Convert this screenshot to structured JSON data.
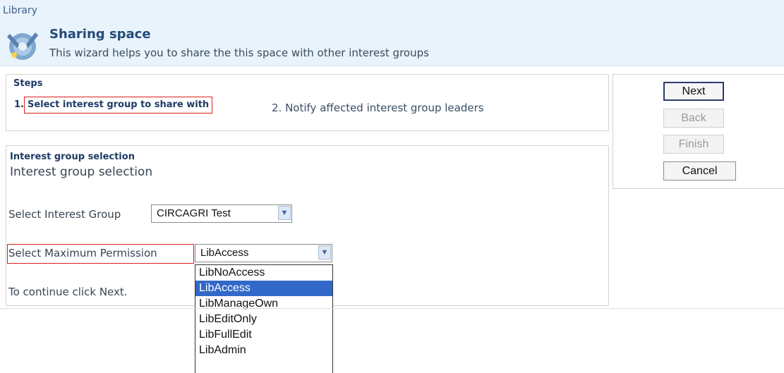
{
  "breadcrumb": "Library",
  "wizard": {
    "title": "Sharing space",
    "description": "This wizard helps you to share the this space with other interest groups"
  },
  "steps": {
    "heading": "Steps",
    "step1_number": "1.",
    "step1_label": "Select interest group to share with",
    "step2": "2. Notify affected interest group leaders"
  },
  "selection": {
    "heading": "Interest group selection",
    "subheading": "Interest group selection",
    "group_label": "Select Interest Group",
    "group_value": "CIRCAGRI Test",
    "permission_label": "Select Maximum Permission",
    "permission_value": "LibAccess",
    "continue_text": "To continue click Next.",
    "permission_options": [
      "LibNoAccess",
      "LibAccess",
      "LibManageOwn",
      "LibEditOnly",
      "LibFullEdit",
      "LibAdmin"
    ],
    "selected_option": "LibAccess"
  },
  "nav": {
    "next": "Next",
    "back": "Back",
    "finish": "Finish",
    "cancel": "Cancel"
  },
  "icons": {
    "wizard": "wizard-gear-icon",
    "dropdown": "chevron-down-icon"
  },
  "colors": {
    "header_bg": "#e8f3fb",
    "title": "#244a78",
    "highlight_border": "#d9211e",
    "selected_option_bg": "#3268c8"
  }
}
